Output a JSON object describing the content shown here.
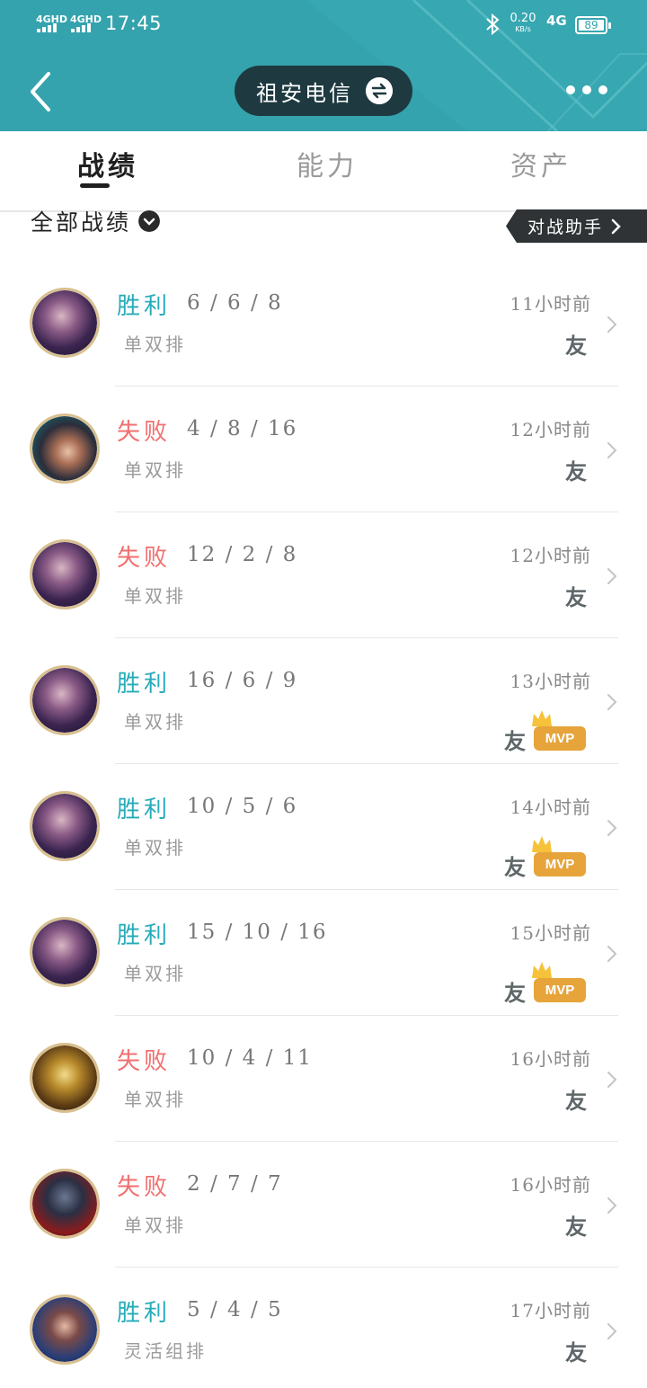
{
  "status_bar": {
    "signal1": "4GHD",
    "signal2": "4GHD",
    "time": "17:45",
    "speed_value": "0.20",
    "speed_unit": "KB/s",
    "network": "4G",
    "battery": "89"
  },
  "header": {
    "account_name": "祖安电信",
    "background_color": "#34a3ad"
  },
  "tabs": [
    {
      "label": "战绩",
      "active": true
    },
    {
      "label": "能力",
      "active": false
    },
    {
      "label": "资产",
      "active": false
    }
  ],
  "filter": {
    "label": "全部战绩",
    "helper_label": "对战助手"
  },
  "colors": {
    "win": "#26abb8",
    "loss": "#f16f6f",
    "mvp": "#e6a43a"
  },
  "matches": [
    {
      "result": "胜利",
      "outcome": "win",
      "kda": "6 / 6 / 8",
      "mode": "单双排",
      "time": "11小时前",
      "friend": "友",
      "mvp": false,
      "avatar_theme": "purple"
    },
    {
      "result": "失败",
      "outcome": "loss",
      "kda": "4 / 8 / 16",
      "mode": "单双排",
      "time": "12小时前",
      "friend": "友",
      "mvp": false,
      "avatar_theme": "teal"
    },
    {
      "result": "失败",
      "outcome": "loss",
      "kda": "12 / 2 / 8",
      "mode": "单双排",
      "time": "12小时前",
      "friend": "友",
      "mvp": false,
      "avatar_theme": "purple"
    },
    {
      "result": "胜利",
      "outcome": "win",
      "kda": "16 / 6 / 9",
      "mode": "单双排",
      "time": "13小时前",
      "friend": "友",
      "mvp": true,
      "mvp_label": "MVP",
      "avatar_theme": "purple"
    },
    {
      "result": "胜利",
      "outcome": "win",
      "kda": "10 / 5 / 6",
      "mode": "单双排",
      "time": "14小时前",
      "friend": "友",
      "mvp": true,
      "mvp_label": "MVP",
      "avatar_theme": "purple"
    },
    {
      "result": "胜利",
      "outcome": "win",
      "kda": "15 / 10 / 16",
      "mode": "单双排",
      "time": "15小时前",
      "friend": "友",
      "mvp": true,
      "mvp_label": "MVP",
      "avatar_theme": "purple"
    },
    {
      "result": "失败",
      "outcome": "loss",
      "kda": "10 / 4 / 11",
      "mode": "单双排",
      "time": "16小时前",
      "friend": "友",
      "mvp": false,
      "avatar_theme": "gold"
    },
    {
      "result": "失败",
      "outcome": "loss",
      "kda": "2 / 7 / 7",
      "mode": "单双排",
      "time": "16小时前",
      "friend": "友",
      "mvp": false,
      "avatar_theme": "red"
    },
    {
      "result": "胜利",
      "outcome": "win",
      "kda": "5 / 4 / 5",
      "mode": "灵活组排",
      "time": "17小时前",
      "friend": "友",
      "mvp": false,
      "avatar_theme": "blue"
    }
  ]
}
